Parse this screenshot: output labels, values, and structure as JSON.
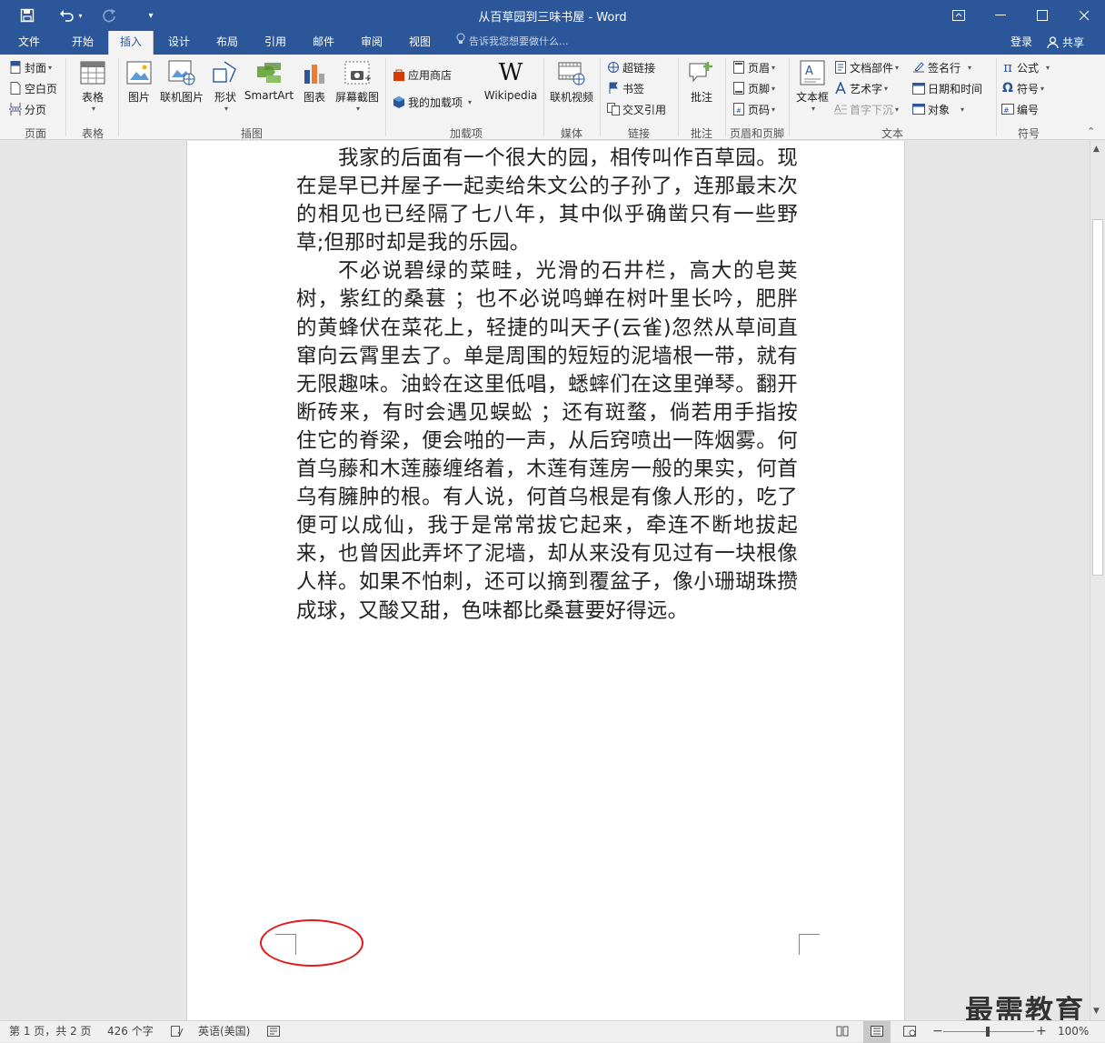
{
  "app": {
    "title": "从百草园到三味书屋 - Word"
  },
  "tabs": [
    {
      "label": "文件"
    },
    {
      "label": "开始"
    },
    {
      "label": "插入"
    },
    {
      "label": "设计"
    },
    {
      "label": "布局"
    },
    {
      "label": "引用"
    },
    {
      "label": "邮件"
    },
    {
      "label": "审阅"
    },
    {
      "label": "视图"
    }
  ],
  "tellme": "告诉我您想要做什么...",
  "account": {
    "login": "登录",
    "share": "共享"
  },
  "ribbon": {
    "pages": {
      "cover": "封面",
      "blank": "空白页",
      "break": "分页",
      "group": "页面"
    },
    "tables": {
      "table": "表格",
      "group": "表格"
    },
    "illustrations": {
      "picture": "图片",
      "online_picture": "联机图片",
      "shapes": "形状",
      "smartart": "SmartArt",
      "chart": "图表",
      "screenshot": "屏幕截图",
      "group": "插图"
    },
    "addins": {
      "store": "应用商店",
      "my_addins": "我的加载项",
      "wikipedia": "Wikipedia",
      "group": "加载项"
    },
    "media": {
      "online_video": "联机视频",
      "group": "媒体"
    },
    "links": {
      "hyperlink": "超链接",
      "bookmark": "书签",
      "crossref": "交叉引用",
      "group": "链接"
    },
    "comments": {
      "comment": "批注",
      "group": "批注"
    },
    "header_footer": {
      "header": "页眉",
      "footer": "页脚",
      "page_number": "页码",
      "group": "页眉和页脚"
    },
    "text": {
      "textbox": "文本框",
      "quick_parts": "文档部件",
      "wordart": "艺术字",
      "dropcap": "首字下沉",
      "signature": "签名行",
      "datetime": "日期和时间",
      "object": "对象",
      "group": "文本"
    },
    "symbols": {
      "equation": "公式",
      "symbol": "符号",
      "numbering": "编号",
      "group": "符号"
    }
  },
  "document": {
    "paragraphs": [
      {
        "lines": [
          "我家的后面有一个很大的园，相传叫作百草园。",
          "现在是早已并屋子一起卖给朱文公的子孙了，连那最",
          "末次的相见也已经隔了七八年，其中似乎确凿只有一",
          "些野草;但那时却是我的乐园。"
        ]
      },
      {
        "lines": [
          "不必说碧绿的菜畦，光滑的石井栏，高大的皂荚",
          "树，紫红的桑葚 ；也不必说鸣蝉在树叶里长吟，肥胖",
          "的黄蜂伏在菜花上，轻捷的叫天子(云雀)忽然从草间",
          "直窜向云霄里去了。单是周围的短短的泥墙根一带，",
          "就有无限趣味。油蛉在这里低唱，蟋蟀们在这里弹琴。",
          "翻开断砖来，有时会遇见蜈蚣 ；还有斑蝥，倘若用手",
          "指按住它的脊梁，便会啪的一声，从后窍喷出一阵烟",
          "雾。何首乌藤和木莲藤缠络着，木莲有莲房一般的果",
          "实，何首乌有臃肿的根。有人说，何首乌根是有像人",
          "形的，吃了便可以成仙，我于是常常拔它起来，牵连",
          "不断地拔起来，也曾因此弄坏了泥墙，却从来没有见",
          "过有一块根像人样。如果不怕刺，还可以摘到覆盆子，",
          "像小珊瑚珠攒成球，又酸又甜，色味都比桑葚要好得",
          "远。"
        ]
      }
    ]
  },
  "status": {
    "page": "第 1 页，共 2 页",
    "words": "426 个字",
    "language": "英语(美国)",
    "zoom": "100%"
  },
  "watermark": "最需教育",
  "colors": {
    "accent": "#2b579a",
    "annotation": "#e21a1a"
  }
}
